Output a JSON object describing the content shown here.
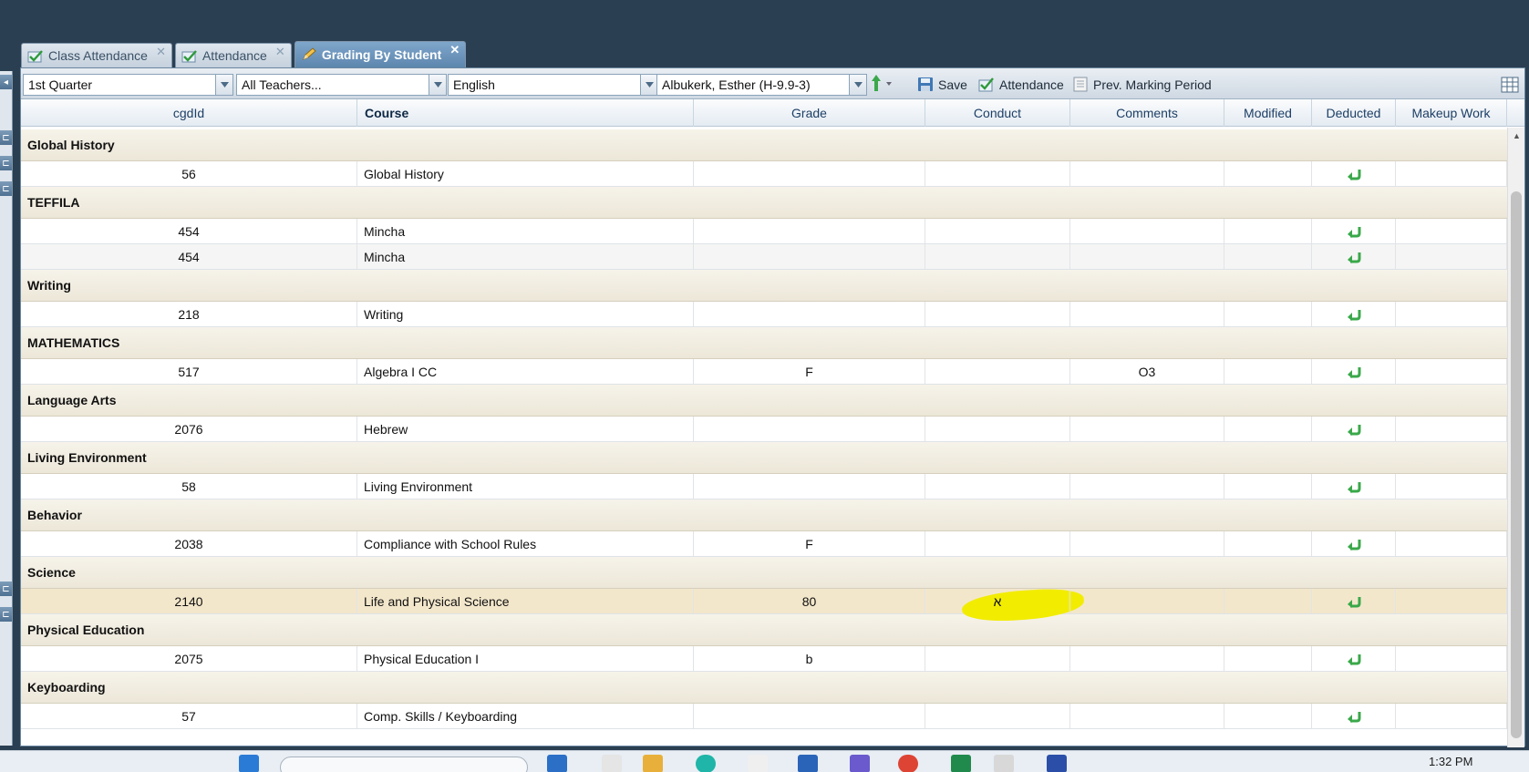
{
  "tabs": [
    {
      "label": "Class Attendance",
      "active": false
    },
    {
      "label": "Attendance",
      "active": false
    },
    {
      "label": "Grading By Student",
      "active": true
    }
  ],
  "toolbar": {
    "marking_period": "1st Quarter",
    "teacher": "All Teachers...",
    "language": "English",
    "student": "Albukerk, Esther (H-9.9-3)",
    "save_label": "Save",
    "attendance_label": "Attendance",
    "prev_period_label": "Prev. Marking Period"
  },
  "columns": [
    "cgdId",
    "Course",
    "Grade",
    "Conduct",
    "Comments",
    "Modified",
    "Deducted",
    "Makeup Work"
  ],
  "groups": [
    {
      "name": "Global History",
      "rows": [
        {
          "id": "56",
          "course": "Global History",
          "grade": "",
          "conduct": "",
          "comments": ""
        }
      ]
    },
    {
      "name": "TEFFILA",
      "rows": [
        {
          "id": "454",
          "course": "Mincha",
          "grade": "",
          "conduct": "",
          "comments": ""
        },
        {
          "id": "454",
          "course": "Mincha",
          "grade": "",
          "conduct": "",
          "comments": ""
        }
      ]
    },
    {
      "name": "Writing",
      "rows": [
        {
          "id": "218",
          "course": "Writing",
          "grade": "",
          "conduct": "",
          "comments": ""
        }
      ]
    },
    {
      "name": "MATHEMATICS",
      "rows": [
        {
          "id": "517",
          "course": "Algebra I CC",
          "grade": "F",
          "conduct": "",
          "comments": "O3"
        }
      ]
    },
    {
      "name": "Language Arts",
      "rows": [
        {
          "id": "2076",
          "course": "Hebrew",
          "grade": "",
          "conduct": "",
          "comments": ""
        }
      ]
    },
    {
      "name": "Living Environment",
      "rows": [
        {
          "id": "58",
          "course": "Living Environment",
          "grade": "",
          "conduct": "",
          "comments": ""
        }
      ]
    },
    {
      "name": "Behavior",
      "rows": [
        {
          "id": "2038",
          "course": "Compliance with School Rules",
          "grade": "F",
          "conduct": "",
          "comments": ""
        }
      ]
    },
    {
      "name": "Science",
      "rows": [
        {
          "id": "2140",
          "course": "Life and Physical Science",
          "grade": "80",
          "conduct": "א",
          "comments": "",
          "selected": true,
          "highlight": true
        }
      ]
    },
    {
      "name": "Physical Education",
      "rows": [
        {
          "id": "2075",
          "course": "Physical Education I",
          "grade": "b",
          "conduct": "",
          "comments": ""
        }
      ]
    },
    {
      "name": "Keyboarding",
      "rows": [
        {
          "id": "57",
          "course": "Comp. Skills / Keyboarding",
          "grade": "",
          "conduct": "",
          "comments": ""
        }
      ]
    }
  ],
  "taskbar": {
    "time": "1:32 PM"
  },
  "colors": {
    "accent": "#5d86ae",
    "group_bg": "#ece7d8",
    "highlight": "#f2ec00",
    "undo_icon": "#3aa84a"
  }
}
